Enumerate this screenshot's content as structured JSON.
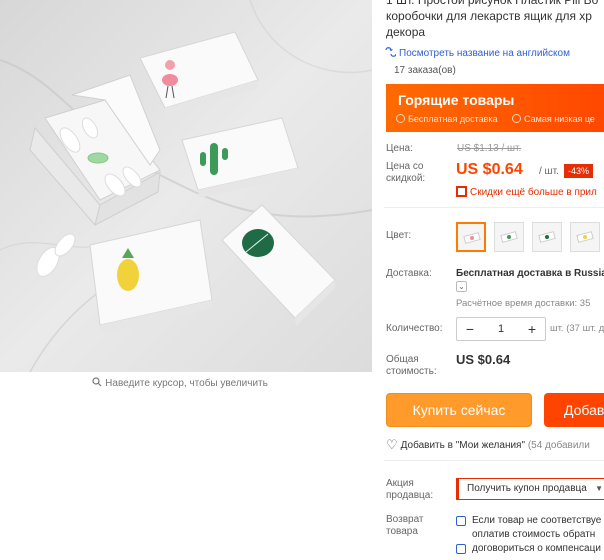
{
  "photo": {
    "zoom_hint": "Наведите курсор, чтобы увеличить"
  },
  "product": {
    "title_line1": "1 Шт. Простой рисунок Пластик Pill Bo",
    "title_line2": "коробочки для лекарств ящик для хр",
    "title_line3": "декора",
    "translate_link": "Посмотреть название на английском",
    "orders": "17 заказа(ов)"
  },
  "hot_deals": {
    "title": "Горящие товары",
    "tag_free_shipping": "Бесплатная доставка",
    "tag_lowest_price": "Самая низкая це"
  },
  "price": {
    "label": "Цена:",
    "old": "US $1.13 / шт.",
    "discount_label": "Цена со скидкой:",
    "new": "US $0.64",
    "per_unit": "/ шт.",
    "discount_badge": "-43%",
    "more_discounts": "Скидки ещё больше в прил"
  },
  "color": {
    "label": "Цвет:",
    "swatches": [
      "flamingo",
      "cactus",
      "monstera",
      "pineapple"
    ]
  },
  "shipping": {
    "label": "Доставка:",
    "value": "Бесплатная доставка в Russia",
    "dropdown": "⌄",
    "time": "Расчётное время доставки: 35"
  },
  "quantity": {
    "label": "Количество:",
    "value": "1",
    "minus": "−",
    "plus": "+",
    "unit": "шт. (37 шт. д"
  },
  "total": {
    "label": "Общая стоимость:",
    "value": "US $0.64"
  },
  "actions": {
    "buy_now": "Купить сейчас",
    "add_to_cart": "Добав",
    "wishlist": "Добавить в \"Мои желания\"",
    "wishlist_count": "(54 добавили"
  },
  "seller": {
    "promo_label": "Акция продавца:",
    "coupon": "Получить купон продавца",
    "return_label": "Возврат товара",
    "return_line1": "Если товар не соответствуе",
    "return_line2": "оплатив стоимость обратн",
    "return_line3": "договориться о компенсаци"
  },
  "colors": {
    "accent": "#ff4400",
    "buy_button": "#ff9a2b",
    "link": "#2d5fd8"
  }
}
